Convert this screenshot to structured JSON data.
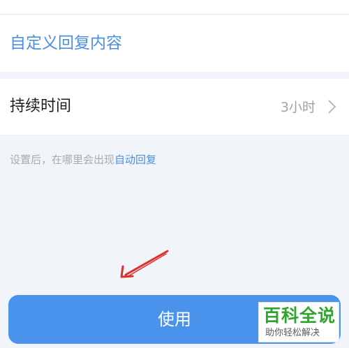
{
  "reply_card": {
    "custom_reply_label": "自定义回复内容"
  },
  "duration": {
    "label": "持续时间",
    "value": "3小时",
    "chevron_icon": "chevron-right-icon"
  },
  "hint": {
    "text": "设置后，在哪里会出现",
    "link": "自动回复"
  },
  "annotation": {
    "arrow_icon": "red-arrow-icon",
    "arrow_color": "#e0302a"
  },
  "use_button": {
    "label": "使用",
    "color": "#4a93ec"
  },
  "watermark": {
    "title": "百科全说",
    "subtitle": "助你轻松解决"
  },
  "colors": {
    "accent": "#4b8fe0",
    "background": "#f1f4f9",
    "watermark_green": "#2ea52e"
  }
}
